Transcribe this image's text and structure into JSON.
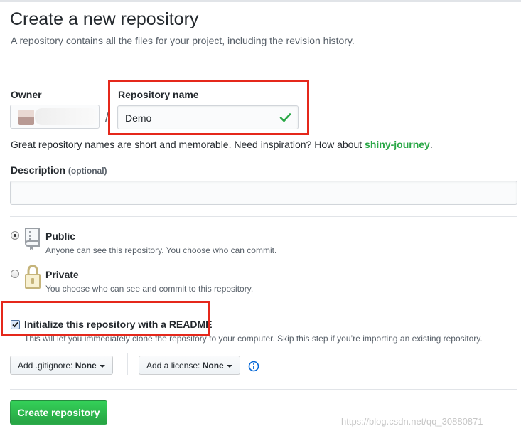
{
  "header": {
    "title": "Create a new repository",
    "subtitle": "A repository contains all the files for your project, including the revision history."
  },
  "owner": {
    "label": "Owner"
  },
  "separator": "/",
  "repo_name": {
    "label": "Repository name",
    "value": "Demo",
    "valid_icon": "check-icon"
  },
  "hint": {
    "text": "Great repository names are short and memorable. Need inspiration? How about ",
    "suggestion": "shiny-journey",
    "end": "."
  },
  "description": {
    "label": "Description",
    "optional": "(optional)",
    "value": ""
  },
  "visibility": {
    "public": {
      "title": "Public",
      "desc": "Anyone can see this repository. You choose who can commit.",
      "selected": true,
      "icon": "repo-book-icon"
    },
    "private": {
      "title": "Private",
      "desc": "You choose who can see and commit to this repository.",
      "selected": false,
      "icon": "lock-icon"
    }
  },
  "readme": {
    "label": "Initialize this repository with a README",
    "checked": true,
    "desc": "This will let you immediately clone the repository to your computer. Skip this step if you’re importing an existing repository."
  },
  "gitignore": {
    "prefix": "Add .gitignore: ",
    "value": "None"
  },
  "license": {
    "prefix": "Add a license: ",
    "value": "None"
  },
  "submit": {
    "label": "Create repository"
  },
  "watermark": "https://blog.csdn.net/qq_30880871",
  "colors": {
    "primary_button": "#28a745",
    "highlight_box": "#e5281b",
    "suggestion": "#28a745"
  }
}
